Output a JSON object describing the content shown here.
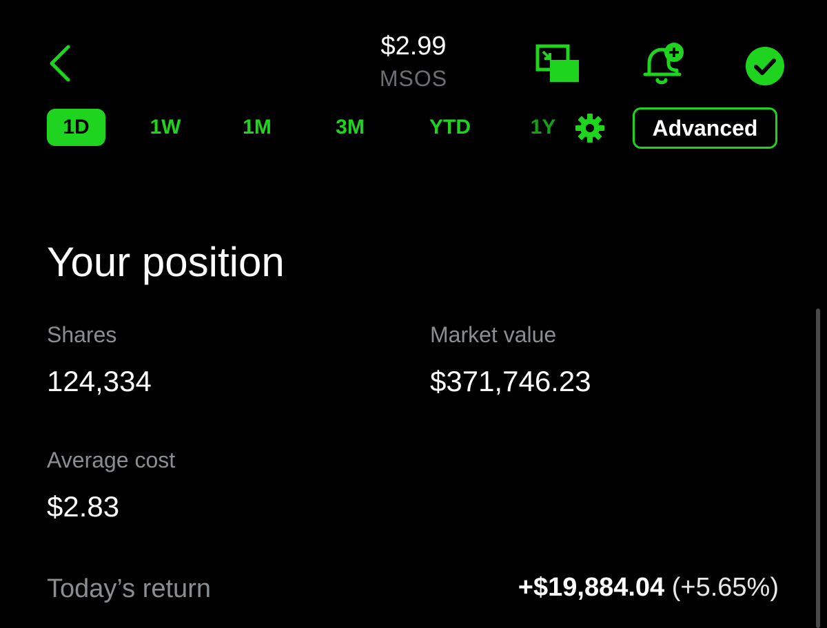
{
  "header": {
    "price": "$2.99",
    "ticker": "MSOS",
    "back_icon": "chevron-left-icon",
    "pip_icon": "picture-in-picture-icon",
    "alert_icon": "bell-plus-icon",
    "watchlist_icon": "check-circle-icon"
  },
  "range_tabs": {
    "items": [
      "1D",
      "1W",
      "1M",
      "3M",
      "YTD",
      "1Y"
    ],
    "selected": "1D",
    "settings_icon": "gear-icon",
    "advanced_label": "Advanced"
  },
  "position": {
    "title": "Your position",
    "shares_label": "Shares",
    "shares_value": "124,334",
    "market_value_label": "Market value",
    "market_value": "$371,746.23",
    "avg_cost_label": "Average cost",
    "avg_cost_value": "$2.83",
    "todays_return_label": "Today’s return",
    "todays_return_amount": "+$19,884.04",
    "todays_return_percent": "(+5.65%)"
  },
  "colors": {
    "accent": "#1ed41e",
    "background": "#000000",
    "text": "#ffffff",
    "muted": "#8a8e92"
  }
}
